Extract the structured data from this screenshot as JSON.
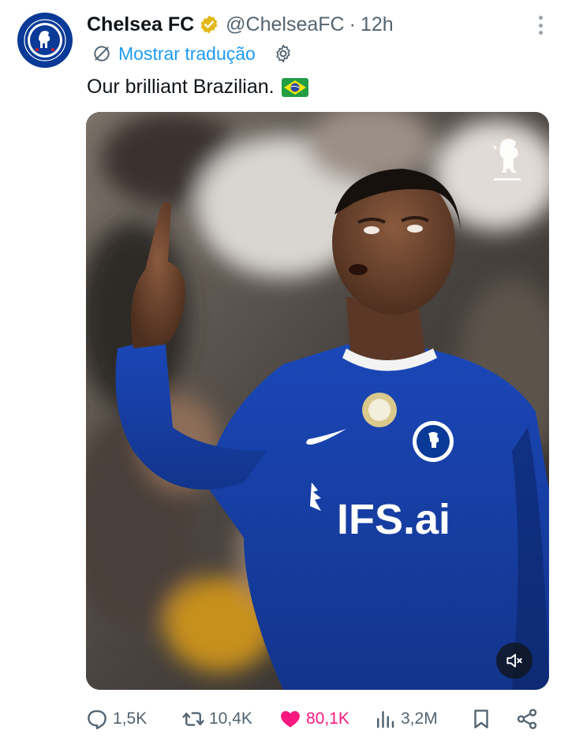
{
  "author": {
    "name": "Chelsea FC",
    "handle": "@ChelseaFC",
    "separator": "·",
    "time": "12h",
    "avatar_icon": "chelsea-crest-icon",
    "verified_icon": "verified-gold-badge-icon"
  },
  "translate": {
    "label": "Mostrar tradução",
    "icon": "translate-icon",
    "settings_icon": "gear-icon"
  },
  "tweet": {
    "text": "Our brilliant Brazilian.",
    "emoji": "brazil-flag-icon"
  },
  "media": {
    "type": "video",
    "overlay_icon": "chelsea-lion-icon",
    "mute_icon": "speaker-muted-icon",
    "jersey_sponsor": "IFS.ai"
  },
  "actions": {
    "reply": "1,5K",
    "repost": "10,4K",
    "like": "80,1K",
    "views": "3,2M",
    "bookmark_icon": "bookmark-icon",
    "share_icon": "share-icon"
  },
  "colors": {
    "link": "#1d9bf0",
    "like": "#f91880",
    "muted_text": "#536471",
    "chelsea_blue": "#0a3a97"
  }
}
